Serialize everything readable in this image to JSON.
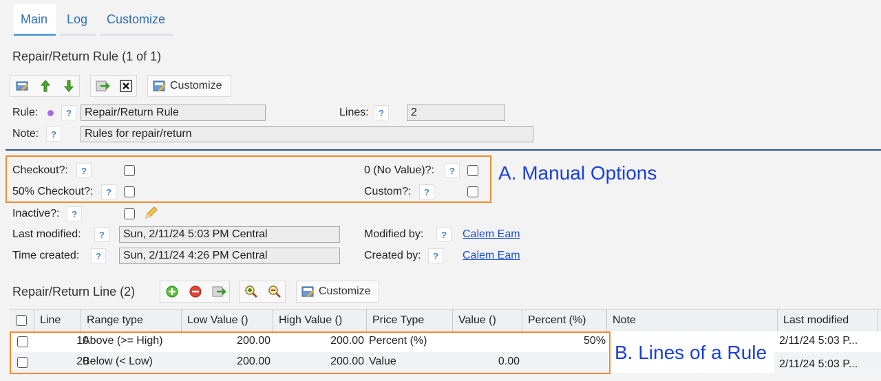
{
  "tabs": [
    {
      "label": "Main",
      "active": true
    },
    {
      "label": "Log",
      "active": false
    },
    {
      "label": "Customize",
      "active": false
    }
  ],
  "header": {
    "title": "Repair/Return Rule (1 of 1)"
  },
  "toolbar": {
    "customize_label": "Customize"
  },
  "form": {
    "rule_label": "Rule:",
    "rule_value": "Repair/Return Rule",
    "lines_label": "Lines:",
    "lines_value": "2",
    "note_label": "Note:",
    "note_value": "Rules for repair/return",
    "checkout_label": "Checkout?:",
    "checkout50_label": "50% Checkout?:",
    "novalue_label": "0 (No Value)?:",
    "custom_label": "Custom?:",
    "inactive_label": "Inactive?:",
    "last_modified_label": "Last modified:",
    "last_modified_value": "Sun, 2/11/24 5:03 PM Central",
    "time_created_label": "Time created:",
    "time_created_value": "Sun, 2/11/24 4:26 PM Central",
    "modified_by_label": "Modified by:",
    "modified_by_value": "Calem Eam",
    "created_by_label": "Created by:",
    "created_by_value": "Calem Eam",
    "help": "?"
  },
  "annotations": {
    "a": "A. Manual Options",
    "b": "B. Lines of a Rule"
  },
  "lines_section": {
    "title": "Repair/Return Line (2)",
    "customize_label": "Customize"
  },
  "grid": {
    "columns": [
      "Line",
      "Range type",
      "Low Value ()",
      "High Value ()",
      "Price Type",
      "Value ()",
      "Percent (%)",
      "Note",
      "Last modified"
    ],
    "rows": [
      {
        "line": "10",
        "range_type": "Above (>= High)",
        "low": "200.00",
        "high": "200.00",
        "price_type": "Percent (%)",
        "value": "",
        "percent": "50%",
        "note": "",
        "last_modified": "2/11/24 5:03 P..."
      },
      {
        "line": "20",
        "range_type": "Below (< Low)",
        "low": "200.00",
        "high": "200.00",
        "price_type": "Value",
        "value": "0.00",
        "percent": "",
        "note": "",
        "last_modified": "2/11/24 5:03 P..."
      }
    ]
  },
  "colors": {
    "accent": "#2f6fb0",
    "callout_border": "#f08a2e",
    "callout_text": "#1a3ee0",
    "link": "#1a4fd6",
    "divider": "#2d4f8e"
  }
}
